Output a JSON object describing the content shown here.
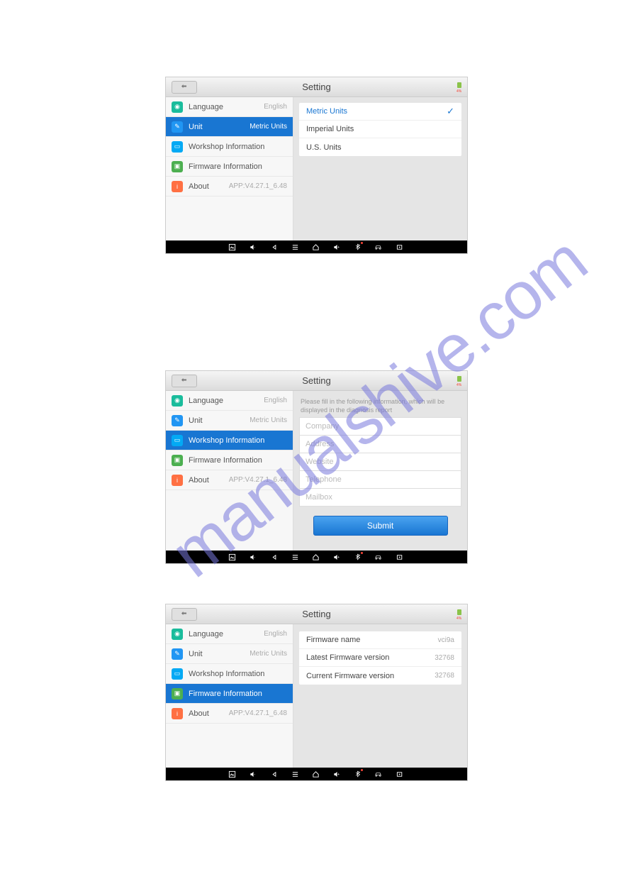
{
  "watermark": "manualshive.com",
  "header": {
    "title": "Setting"
  },
  "sidebar": {
    "items": [
      {
        "label": "Language",
        "value": "English"
      },
      {
        "label": "Unit",
        "value": "Metric Units"
      },
      {
        "label": "Workshop Information",
        "value": ""
      },
      {
        "label": "Firmware Information",
        "value": ""
      },
      {
        "label": "About",
        "value": "APP:V4.27.1_6.48"
      }
    ]
  },
  "unit_panel": {
    "options": [
      {
        "label": "Metric Units",
        "selected": true
      },
      {
        "label": "Imperial Units",
        "selected": false
      },
      {
        "label": "U.S. Units",
        "selected": false
      }
    ]
  },
  "workshop_panel": {
    "helper": "Please fill in the following information, which will be displayed in the diagnosis report",
    "fields": {
      "company": "Company",
      "address": "Address",
      "website": "Website",
      "telephone": "Telephone",
      "mailbox": "Mailbox"
    },
    "submit": "Submit"
  },
  "firmware_panel": {
    "rows": [
      {
        "label": "Firmware name",
        "value": "vci9a"
      },
      {
        "label": "Latest Firmware version",
        "value": "32768"
      },
      {
        "label": "Current Firmware version",
        "value": "32768"
      }
    ]
  }
}
